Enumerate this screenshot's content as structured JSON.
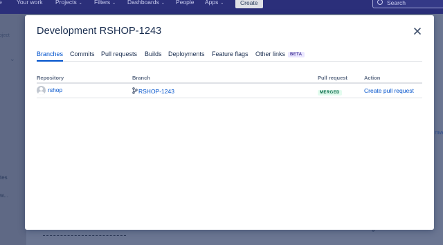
{
  "background": {
    "nav": {
      "your_work": "Your work",
      "projects": "Projects",
      "filters": "Filters",
      "dashboards": "Dashboards",
      "people": "People",
      "apps": "Apps",
      "create": "Create",
      "search_placeholder": "Search"
    },
    "side_fragments": [
      "oject",
      "tes",
      "w..."
    ],
    "right_fragment": "mw",
    "far_right_fragment": "g"
  },
  "modal": {
    "title": "Development RSHOP-1243",
    "tabs": [
      {
        "label": "Branches"
      },
      {
        "label": "Commits"
      },
      {
        "label": "Pull requests"
      },
      {
        "label": "Builds"
      },
      {
        "label": "Deployments"
      },
      {
        "label": "Feature flags"
      },
      {
        "label": "Other links",
        "badge": "BETA"
      }
    ],
    "table": {
      "headers": {
        "repository": "Repository",
        "branch": "Branch",
        "pull_request": "Pull request",
        "action": "Action"
      },
      "rows": [
        {
          "repository": "rshop",
          "branch": "RSHOP-1243",
          "pull_request": "MERGED",
          "action": "Create pull request"
        }
      ]
    }
  },
  "colors": {
    "accent": "#0052cc",
    "merged_bg": "#e3fcef",
    "merged_text": "#006644",
    "beta_bg": "#eae6ff",
    "beta_text": "#403294"
  }
}
